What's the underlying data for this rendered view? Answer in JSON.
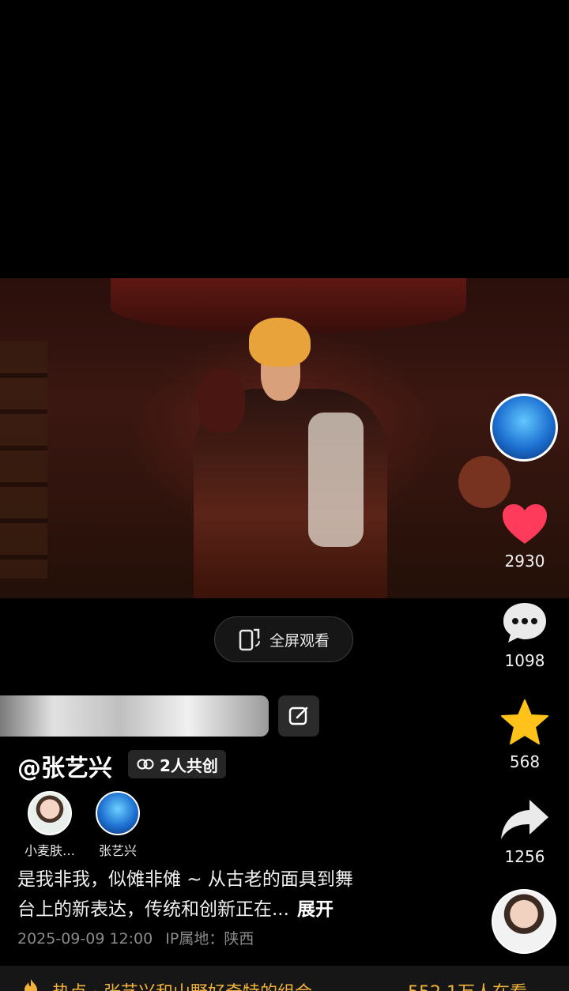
{
  "player": {
    "fullscreen_label": "全屏观看"
  },
  "actions": {
    "likes": "2930",
    "comments": "1098",
    "favorites": "568",
    "shares": "1256"
  },
  "post": {
    "author": "@张艺兴",
    "co_create_label": "2人共创",
    "creators": [
      {
        "name": "小麦肤…"
      },
      {
        "name": "张艺兴"
      }
    ],
    "caption_line1": "是我非我，似傩非傩 ~ 从古老的面具到舞",
    "caption_line2": "台上的新表达，传统和创新正在...",
    "expand_label": "展开",
    "date": "2025-09-09 12:00",
    "ip_location": "IP属地：陕西"
  },
  "hot_topic": {
    "prefix": "热点 · 张艺兴和山野好奇特的组合",
    "watching": "552.1万人在看"
  },
  "colors": {
    "like": "#ff3b5c",
    "favorite": "#ffc21a",
    "hot": "#f0b23a"
  }
}
